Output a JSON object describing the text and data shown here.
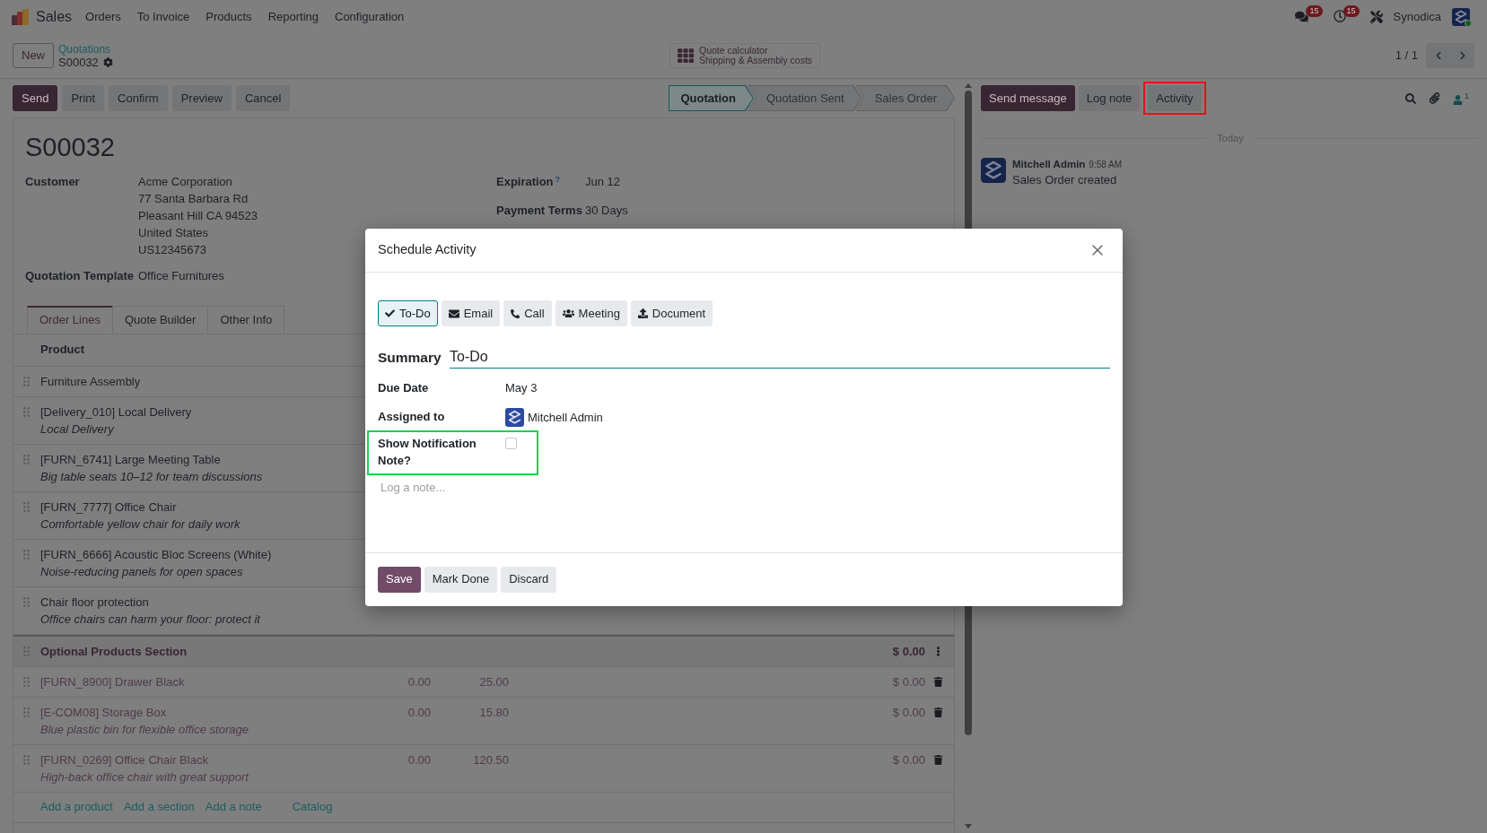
{
  "navbar": {
    "app_name": "Sales",
    "menu": [
      "Orders",
      "To Invoice",
      "Products",
      "Reporting",
      "Configuration"
    ],
    "indicators": [
      {
        "kind": "messages",
        "count": "15"
      },
      {
        "kind": "activities",
        "count": "15"
      }
    ],
    "company": "Synodica",
    "user_online": true
  },
  "control_panel": {
    "new_button": "New",
    "breadcrumb": "Quotations",
    "record_name": "S00032",
    "quote_calculator": {
      "title": "Quote calculator",
      "subtitle": "Shipping & Assembly costs"
    },
    "pager": "1 / 1"
  },
  "action_buttons": [
    {
      "label": "Send",
      "kind": "primary"
    },
    {
      "label": "Print",
      "kind": "secondary"
    },
    {
      "label": "Confirm",
      "kind": "secondary"
    },
    {
      "label": "Preview",
      "kind": "secondary"
    },
    {
      "label": "Cancel",
      "kind": "secondary"
    }
  ],
  "status_bar": [
    {
      "label": "Quotation",
      "selected": true
    },
    {
      "label": "Quotation Sent",
      "selected": false
    },
    {
      "label": "Sales Order",
      "selected": false
    }
  ],
  "form": {
    "title": "S00032",
    "left_fields": [
      {
        "label": "Customer",
        "lines": [
          "Acme Corporation",
          "77 Santa Barbara Rd",
          "Pleasant Hill CA 94523",
          "United States",
          "US12345673"
        ]
      },
      {
        "label": "Quotation Template",
        "lines": [
          "Office Furnitures"
        ]
      }
    ],
    "right_fields": [
      {
        "label": "Expiration$^{?}$",
        "value": "Jun 12"
      },
      {
        "label": "Payment Terms",
        "value": "30 Days"
      }
    ],
    "tabs": [
      {
        "label": "Order Lines",
        "selected": true
      },
      {
        "label": "Quote Builder",
        "selected": false
      },
      {
        "label": "Other Info",
        "selected": false
      }
    ],
    "order_lines": {
      "column_1": "Product",
      "rows": [
        {
          "kind": "line",
          "product": "Furniture Assembly"
        },
        {
          "kind": "line",
          "product": "[Delivery_010] Local Delivery",
          "description": "Local Delivery"
        },
        {
          "kind": "line",
          "product": "[FURN_6741] Large Meeting Table",
          "description": "Big table seats 10–12 for team discussions"
        },
        {
          "kind": "line",
          "product": "[FURN_7777] Office Chair",
          "description": "Comfortable yellow chair for daily work"
        },
        {
          "kind": "line",
          "product": "[FURN_6666] Acoustic Bloc Screens (White)",
          "description": "Noise-reducing panels for open spaces"
        },
        {
          "kind": "line",
          "product": "Chair floor protection",
          "description": "Office chairs can harm your floor: protect it"
        },
        {
          "kind": "section",
          "product": "Optional Products Section",
          "column_4": "$ 0.00"
        },
        {
          "kind": "optional",
          "product": "[FURN_8900] Drawer Black",
          "column_2": "0.00",
          "column_3": "25.00",
          "column_4": "$ 0.00"
        },
        {
          "kind": "optional",
          "product": "[E-COM08] Storage Box",
          "description": "Blue plastic bin for flexible office storage",
          "column_2": "0.00",
          "column_3": "15.80",
          "column_4": "$ 0.00"
        },
        {
          "kind": "optional",
          "product": "[FURN_0269] Office Chair Black",
          "description": "High-back office chair with great support",
          "column_2": "0.00",
          "column_3": "120.50",
          "column_4": "$ 0.00"
        }
      ],
      "links": [
        "Add a product",
        "Add a section",
        "Add a note",
        "Catalog"
      ]
    }
  },
  "chatter": {
    "buttons": [
      {
        "label": "Send message",
        "kind": "primary",
        "highlighted": false
      },
      {
        "label": "Log note",
        "kind": "secondary",
        "highlighted": false
      },
      {
        "label": "Activity",
        "kind": "secondary",
        "highlighted": true
      }
    ],
    "follower_count": "1",
    "date_separator": "Today",
    "messages": [
      {
        "author": "Mitchell Admin",
        "time": "9:58 AM",
        "body": "Sales Order created"
      }
    ]
  },
  "dialog": {
    "title": "Schedule Activity",
    "activity_types": [
      {
        "kind": "todo",
        "label": "To-Do",
        "selected": true
      },
      {
        "kind": "email",
        "label": "Email",
        "selected": false
      },
      {
        "kind": "call",
        "label": "Call",
        "selected": false
      },
      {
        "kind": "meeting",
        "label": "Meeting",
        "selected": false
      },
      {
        "kind": "document",
        "label": "Document",
        "selected": false
      }
    ],
    "summary": {
      "label": "Summary",
      "value": "To-Do"
    },
    "due_date": {
      "label": "Due Date",
      "value": "May 3"
    },
    "assigned_to": {
      "label": "Assigned to",
      "value": "Mitchell Admin"
    },
    "notification_note": {
      "label": "Show Notification Note?",
      "checked": false,
      "highlighted": true
    },
    "note": {
      "placeholder": "Log a note..."
    },
    "buttons": [
      {
        "label": "Save",
        "kind": "primary"
      },
      {
        "label": "Mark Done",
        "kind": "secondary"
      },
      {
        "label": "Discard",
        "kind": "secondary"
      }
    ]
  }
}
